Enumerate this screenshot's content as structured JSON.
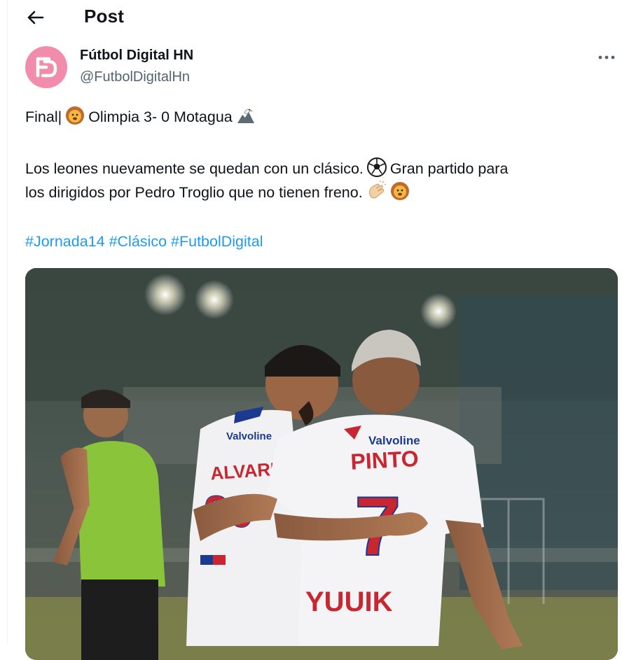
{
  "header": {
    "title": "Post",
    "back_icon": "arrow-left-icon"
  },
  "author": {
    "name": "Fútbol Digital HN",
    "handle": "@FutbolDigitalHn",
    "avatar_letters": "FD",
    "avatar_color": "#f28cad"
  },
  "tweet": {
    "line1_start": "Final|",
    "line1_mid": "Olimpia 3- 0 Motagua",
    "line2_text": "Los leones nuevamente se quedan con un clásico.",
    "line2_end": "Gran partido para",
    "line3_text": "los dirigidos por Pedro Troglio que no tienen freno.",
    "hashtags": [
      "#Jornada14",
      "#Clásico",
      "#FutbolDigital"
    ],
    "hashtag_color": "#1d9bf0"
  },
  "photo": {
    "jersey_left_name": "ALVAREZ",
    "jersey_left_number": "20",
    "jersey_right_name": "PINTO",
    "jersey_right_number": "7",
    "sponsor": "Valvoline",
    "shorts_sponsor": "YUUIK"
  }
}
